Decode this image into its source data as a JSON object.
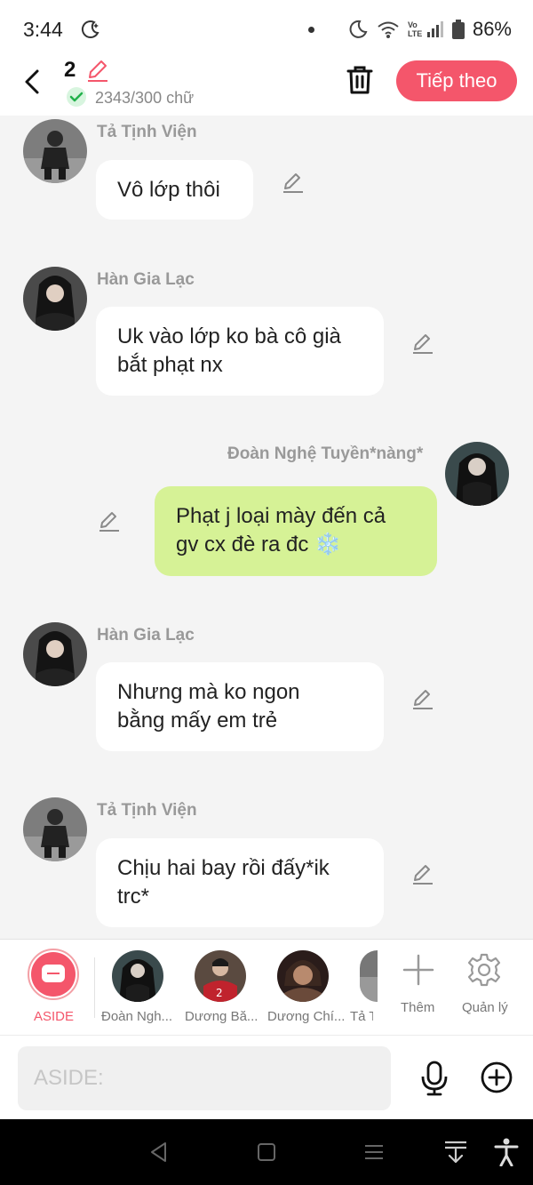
{
  "status": {
    "time": "3:44",
    "battery": "86%",
    "network": "Vo LTE"
  },
  "header": {
    "count": "2",
    "word_count": "2343/300 chữ",
    "next_label": "Tiếp theo"
  },
  "messages": [
    {
      "name": "Tả Tịnh Viện",
      "lines": [
        "Vô lớp thôi"
      ],
      "side": "left"
    },
    {
      "name": "Hàn Gia Lạc",
      "lines": [
        "Uk vào lớp ko bà cô già",
        "bắt phạt nx"
      ],
      "side": "left"
    },
    {
      "name": "Đoàn Nghệ Tuyền*nàng*",
      "lines": [
        "Phạt j loại mày đến cả",
        "gv cx đè ra đc ❄️"
      ],
      "side": "right"
    },
    {
      "name": "Hàn Gia Lạc",
      "lines": [
        "Nhưng mà ko ngon",
        "bằng mấy em trẻ"
      ],
      "side": "left"
    },
    {
      "name": "Tả Tịnh Viện",
      "lines": [
        "Chịu hai bay rồi đấy*ik",
        "trc*"
      ],
      "side": "left"
    }
  ],
  "cast": {
    "aside_label": "ASIDE",
    "characters": [
      "Đoàn Ngh...",
      "Dương Bă...",
      "Dương Chí...",
      "Tả T"
    ],
    "add_label": "Thêm",
    "manage_label": "Quản lý"
  },
  "input": {
    "placeholder": "ASIDE:"
  },
  "colors": {
    "accent": "#f4566b",
    "my_bubble": "#d6f296",
    "background": "#f4f4f4"
  }
}
